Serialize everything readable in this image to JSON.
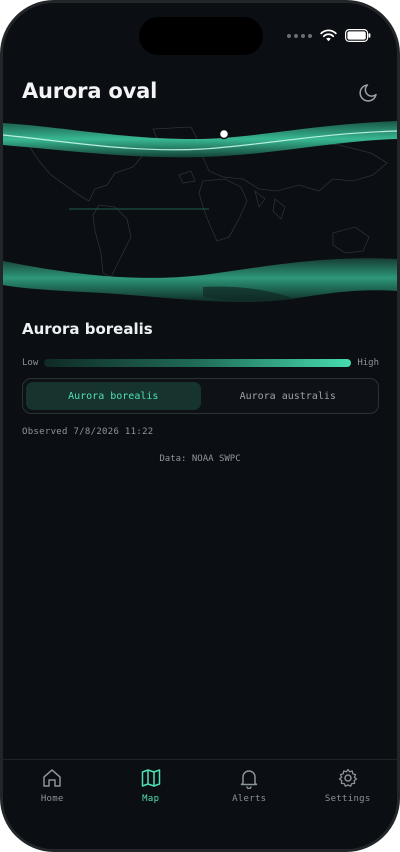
{
  "header": {
    "title": "Aurora oval",
    "theme_icon": "moon-icon"
  },
  "status_bar": {
    "icons": [
      "signal-dots-icon",
      "wifi-icon",
      "battery-icon"
    ]
  },
  "map": {
    "hemisphere_shown": "north and south ovals",
    "marker": "current location"
  },
  "subtitle": "Aurora borealis",
  "legend": {
    "low_label": "Low",
    "high_label": "High",
    "low_color": "#0f2a24",
    "high_color": "#47dcb0"
  },
  "segmented": {
    "options": [
      {
        "label": "Aurora borealis",
        "selected": true
      },
      {
        "label": "Aurora australis",
        "selected": false
      }
    ]
  },
  "observed": "Observed 7/8/2026 11:22",
  "source": "Data: NOAA SWPC",
  "tabbar": {
    "items": [
      {
        "label": "Home",
        "icon": "home-icon",
        "active": false
      },
      {
        "label": "Map",
        "icon": "map-icon",
        "active": true
      },
      {
        "label": "Alerts",
        "icon": "bell-icon",
        "active": false
      },
      {
        "label": "Settings",
        "icon": "gear-icon",
        "active": false
      }
    ]
  },
  "colors": {
    "accent": "#4fe0b4",
    "background": "#0b0e12"
  }
}
